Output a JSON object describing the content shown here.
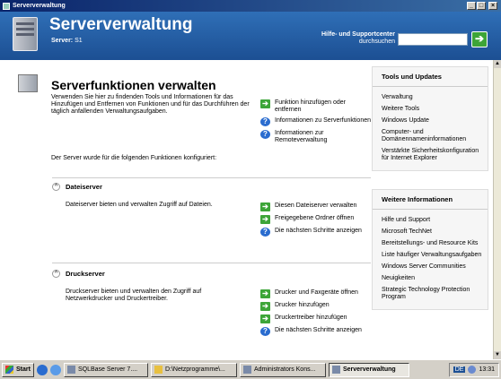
{
  "window": {
    "title": "Serververwaltung",
    "buttons": [
      "_",
      "□",
      "×"
    ]
  },
  "header": {
    "title": "Serververwaltung",
    "server_label": "Server:",
    "server_name": "S1",
    "help_line1": "Hilfe- und Supportcenter",
    "help_line2": "durchsuchen",
    "search_value": "",
    "go_icon": "go-arrow-icon"
  },
  "main": {
    "title": "Serverfunktionen verwalten",
    "intro": "Verwenden Sie hier zu findenden Tools und Informationen für das Hinzufügen und Entfernen von Funktionen und für das Durchführen der täglich anfallenden Verwaltungsaufgaben.",
    "tasks": [
      {
        "icon": "go-arrow-icon",
        "label": "Funktion hinzufügen oder entfernen"
      },
      {
        "icon": "info-icon",
        "label": "Informationen zu Serverfunktionen"
      },
      {
        "icon": "info-icon",
        "label": "Informationen zur Remoteverwaltung"
      }
    ],
    "config_text": "Der Server wurde für die folgenden Funktionen konfiguriert:"
  },
  "sections": [
    {
      "title": "Dateiserver",
      "description": "Dateiserver bieten und verwalten Zugriff auf Dateien.",
      "tasks": [
        {
          "icon": "go-arrow-icon",
          "label": "Diesen Dateiserver verwalten"
        },
        {
          "icon": "go-arrow-icon",
          "label": "Freigegebene Ordner öffnen"
        },
        {
          "icon": "info-icon",
          "label": "Die nächsten Schritte anzeigen"
        }
      ]
    },
    {
      "title": "Druckserver",
      "description": "Druckserver bieten und verwalten den Zugriff auf Netzwerkdrucker und Druckertreiber.",
      "tasks": [
        {
          "icon": "go-arrow-icon",
          "label": "Drucker und Faxgeräte öffnen"
        },
        {
          "icon": "go-arrow-icon",
          "label": "Drucker hinzufügen"
        },
        {
          "icon": "go-arrow-icon",
          "label": "Druckertreiber hinzufügen"
        },
        {
          "icon": "info-icon",
          "label": "Die nächsten Schritte anzeigen"
        }
      ]
    }
  ],
  "sidebar": {
    "tools": {
      "title": "Tools und Updates",
      "items": [
        "Verwaltung",
        "Weitere Tools",
        "Windows Update",
        "Computer- und Domänennameninformationen",
        "Verstärkte Sicherheitskonfiguration für Internet Explorer"
      ]
    },
    "info": {
      "title": "Weitere Informationen",
      "items": [
        "Hilfe und Support",
        "Microsoft TechNet",
        "Bereitstellungs- und Resource Kits",
        "Liste häufiger Verwaltungsaufgaben",
        "Windows Server Communities",
        "Neuigkeiten",
        "Strategic Technology Protection Program"
      ]
    }
  },
  "taskbar": {
    "start": "Start",
    "items": [
      "SQLBase Server 7....",
      "D:\\Netzprogramme\\...",
      "Administrators Kons...",
      "Serververwaltung"
    ],
    "active_index": 3,
    "tray_label": "DE",
    "clock": "13:31"
  }
}
